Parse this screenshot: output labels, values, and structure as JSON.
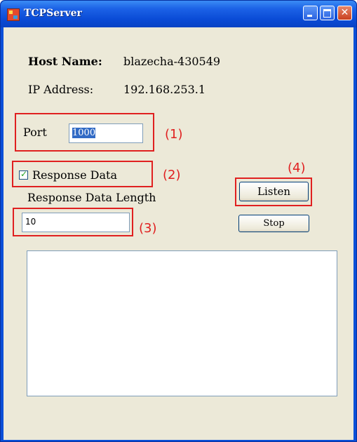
{
  "window": {
    "title": "TCPServer",
    "controls": {
      "minimize": "minimize-icon",
      "maximize": "maximize-icon",
      "close": "close-icon"
    }
  },
  "host": {
    "name_label": "Host Name:",
    "name_value": "blazecha-430549"
  },
  "ip": {
    "label": "IP Address:",
    "value": "192.168.253.1"
  },
  "port": {
    "label": "Port",
    "value": "1000"
  },
  "response_data": {
    "label": "Response Data",
    "checked": true
  },
  "response_length": {
    "label": "Response Data Length",
    "value": "10"
  },
  "buttons": {
    "listen": "Listen",
    "stop": "Stop"
  },
  "annotations": {
    "n1": "(1)",
    "n2": "(2)",
    "n3": "(3)",
    "n4": "(4)"
  },
  "colors": {
    "annotation": "#e02020",
    "titlebar": "#0a4bd6",
    "client": "#ece9d8"
  }
}
